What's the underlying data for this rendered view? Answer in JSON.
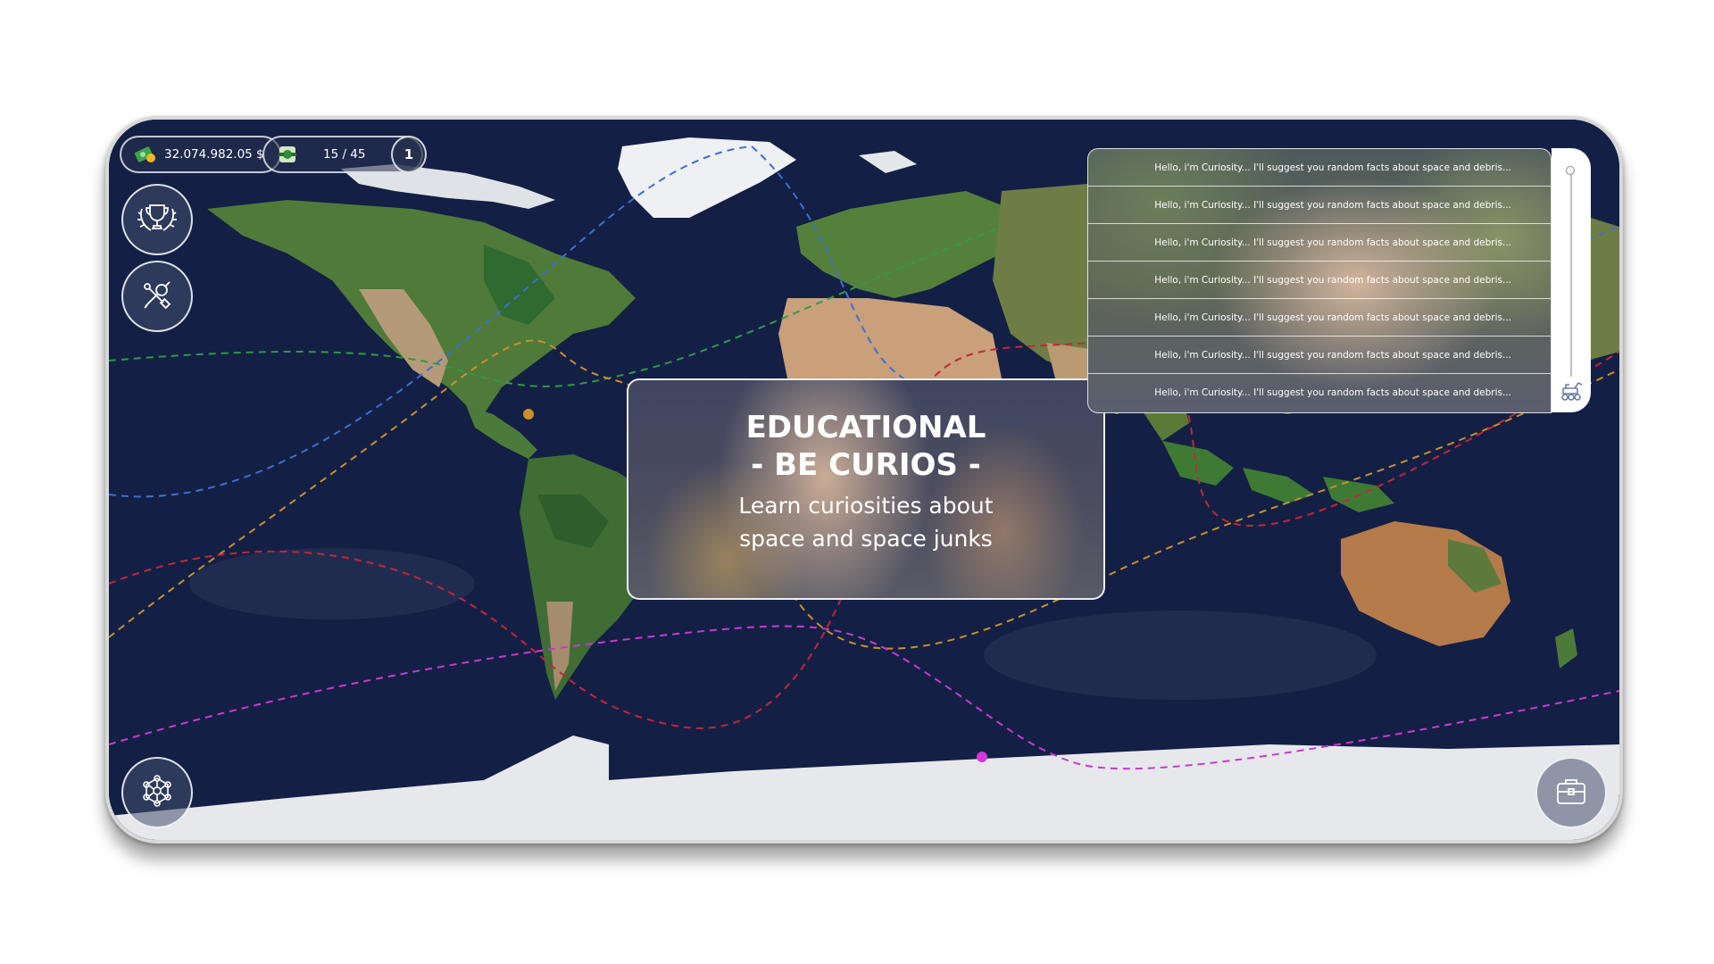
{
  "hud": {
    "money": "32.074.982.05 $",
    "collected": "15 / 45",
    "level": "1"
  },
  "modal": {
    "title": "EDUCATIONAL",
    "subtitle": "- BE CURIOS -",
    "desc_line1": "Learn curiosities about",
    "desc_line2": "space and space junks"
  },
  "facts": [
    "Hello, i'm Curiosity... I'll suggest you random facts about space and debris...",
    "Hello, i'm Curiosity... I'll suggest you random facts about space and debris...",
    "Hello, i'm Curiosity... I'll suggest you random facts about space and debris...",
    "Hello, i'm Curiosity... I'll suggest you random facts about space and debris...",
    "Hello, i'm Curiosity... I'll suggest you random facts about space and debris...",
    "Hello, i'm Curiosity... I'll suggest you random facts about space and debris...",
    "Hello, i'm Curiosity... I'll suggest you random facts about space and debris..."
  ],
  "icons": {
    "money": "cash-icon",
    "collected": "satellite-junk-icon",
    "achievements": "trophy-laurel-icon",
    "tools": "wrench-tools-icon",
    "network": "molecule-network-icon",
    "inventory": "briefcase-icon",
    "rover": "rover-icon"
  },
  "orbit_colors": {
    "blue": "#3d6fd1",
    "green": "#2f9a48",
    "orange": "#c9902a",
    "red": "#c3263a",
    "magenta": "#c93ad0"
  }
}
